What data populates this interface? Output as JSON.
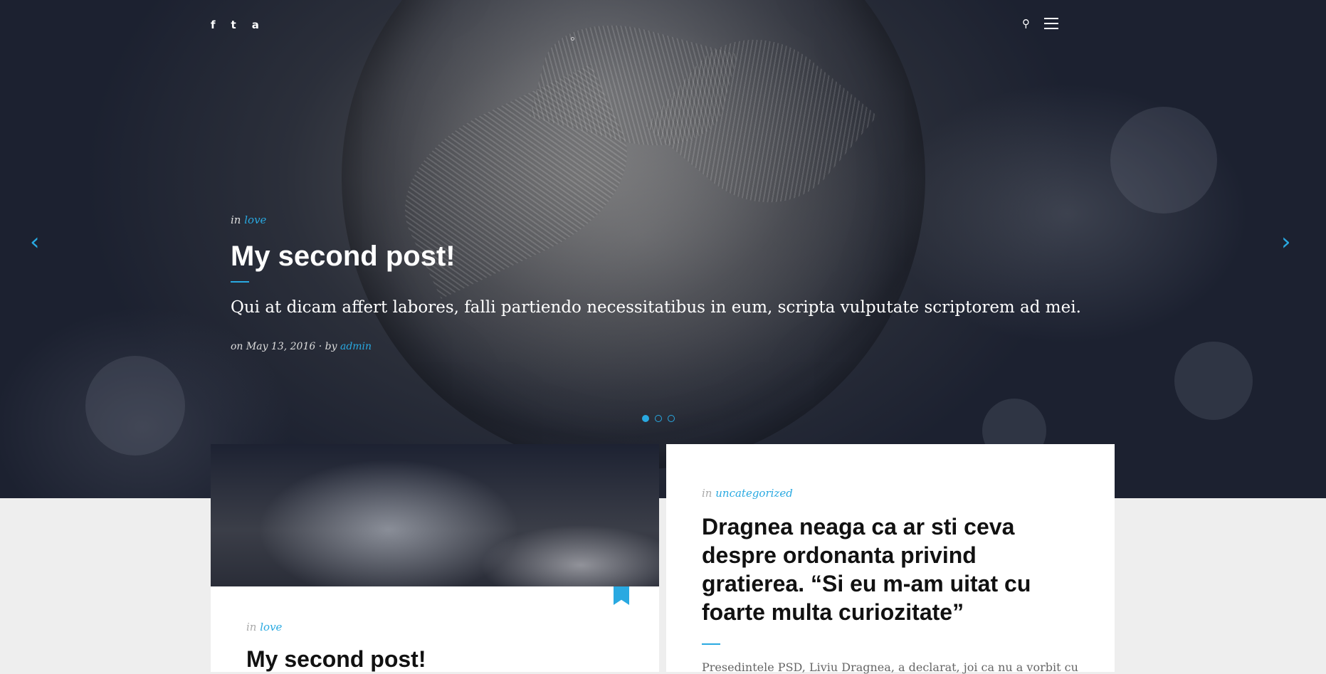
{
  "topbar": {
    "social": [
      {
        "name": "facebook",
        "glyph": "f"
      },
      {
        "name": "twitter",
        "glyph": "t"
      },
      {
        "name": "amazon",
        "glyph": "a"
      }
    ],
    "search_glyph": "⚲"
  },
  "slider": {
    "category_prefix": "in",
    "category": "love",
    "title": "My second post!",
    "excerpt": "Qui at dicam affert labores, falli partiendo necessitatibus in eum, scripta vulputate scriptorem ad mei.",
    "byline_prefix": "on May 13, 2016 · by",
    "author": "admin",
    "prev_glyph": "‹",
    "next_glyph": "›",
    "dots": 3,
    "active_dot": 1
  },
  "cards": {
    "left": {
      "category_prefix": "in",
      "category": "love",
      "title": "My second post!"
    },
    "right": {
      "category_prefix": "in",
      "category": "uncategorized",
      "title": "Dragnea neaga ca ar sti ceva despre ordonanta privind gratierea. “Si eu m-am uitat cu foarte multa curiozitate”",
      "excerpt": "Presedintele PSD, Liviu Dragnea, a declarat, joi ca nu a vorbit cu"
    }
  },
  "colors": {
    "accent": "#29a9e1",
    "page_bg": "#eeeeee"
  }
}
